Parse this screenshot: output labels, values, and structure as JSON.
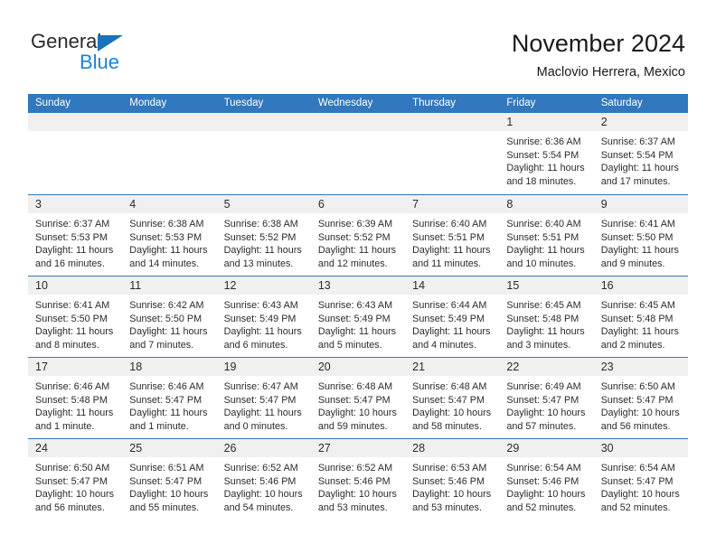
{
  "logo": {
    "word_one": "General",
    "word_two": "Blue",
    "triangle_color": "#1c71b9",
    "blue_color": "#1c82d6"
  },
  "header": {
    "title": "November 2024",
    "subtitle": "Maclovio Herrera, Mexico"
  },
  "theme": {
    "header_bg": "#3178be",
    "header_text": "#ffffff",
    "daynum_band_bg": "#f0f0f0",
    "row_divider": "#3178be",
    "body_text": "#2b2b2b"
  },
  "weekdays": [
    "Sunday",
    "Monday",
    "Tuesday",
    "Wednesday",
    "Thursday",
    "Friday",
    "Saturday"
  ],
  "labels": {
    "sunrise_prefix": "Sunrise:",
    "sunset_prefix": "Sunset:",
    "daylight_prefix": "Daylight:"
  },
  "weeks": [
    [
      {
        "day": "",
        "sunrise": "",
        "sunset": "",
        "daylight_a": "",
        "daylight_b": ""
      },
      {
        "day": "",
        "sunrise": "",
        "sunset": "",
        "daylight_a": "",
        "daylight_b": ""
      },
      {
        "day": "",
        "sunrise": "",
        "sunset": "",
        "daylight_a": "",
        "daylight_b": ""
      },
      {
        "day": "",
        "sunrise": "",
        "sunset": "",
        "daylight_a": "",
        "daylight_b": ""
      },
      {
        "day": "",
        "sunrise": "",
        "sunset": "",
        "daylight_a": "",
        "daylight_b": ""
      },
      {
        "day": "1",
        "sunrise": "Sunrise: 6:36 AM",
        "sunset": "Sunset: 5:54 PM",
        "daylight_a": "Daylight: 11 hours",
        "daylight_b": "and 18 minutes."
      },
      {
        "day": "2",
        "sunrise": "Sunrise: 6:37 AM",
        "sunset": "Sunset: 5:54 PM",
        "daylight_a": "Daylight: 11 hours",
        "daylight_b": "and 17 minutes."
      }
    ],
    [
      {
        "day": "3",
        "sunrise": "Sunrise: 6:37 AM",
        "sunset": "Sunset: 5:53 PM",
        "daylight_a": "Daylight: 11 hours",
        "daylight_b": "and 16 minutes."
      },
      {
        "day": "4",
        "sunrise": "Sunrise: 6:38 AM",
        "sunset": "Sunset: 5:53 PM",
        "daylight_a": "Daylight: 11 hours",
        "daylight_b": "and 14 minutes."
      },
      {
        "day": "5",
        "sunrise": "Sunrise: 6:38 AM",
        "sunset": "Sunset: 5:52 PM",
        "daylight_a": "Daylight: 11 hours",
        "daylight_b": "and 13 minutes."
      },
      {
        "day": "6",
        "sunrise": "Sunrise: 6:39 AM",
        "sunset": "Sunset: 5:52 PM",
        "daylight_a": "Daylight: 11 hours",
        "daylight_b": "and 12 minutes."
      },
      {
        "day": "7",
        "sunrise": "Sunrise: 6:40 AM",
        "sunset": "Sunset: 5:51 PM",
        "daylight_a": "Daylight: 11 hours",
        "daylight_b": "and 11 minutes."
      },
      {
        "day": "8",
        "sunrise": "Sunrise: 6:40 AM",
        "sunset": "Sunset: 5:51 PM",
        "daylight_a": "Daylight: 11 hours",
        "daylight_b": "and 10 minutes."
      },
      {
        "day": "9",
        "sunrise": "Sunrise: 6:41 AM",
        "sunset": "Sunset: 5:50 PM",
        "daylight_a": "Daylight: 11 hours",
        "daylight_b": "and 9 minutes."
      }
    ],
    [
      {
        "day": "10",
        "sunrise": "Sunrise: 6:41 AM",
        "sunset": "Sunset: 5:50 PM",
        "daylight_a": "Daylight: 11 hours",
        "daylight_b": "and 8 minutes."
      },
      {
        "day": "11",
        "sunrise": "Sunrise: 6:42 AM",
        "sunset": "Sunset: 5:50 PM",
        "daylight_a": "Daylight: 11 hours",
        "daylight_b": "and 7 minutes."
      },
      {
        "day": "12",
        "sunrise": "Sunrise: 6:43 AM",
        "sunset": "Sunset: 5:49 PM",
        "daylight_a": "Daylight: 11 hours",
        "daylight_b": "and 6 minutes."
      },
      {
        "day": "13",
        "sunrise": "Sunrise: 6:43 AM",
        "sunset": "Sunset: 5:49 PM",
        "daylight_a": "Daylight: 11 hours",
        "daylight_b": "and 5 minutes."
      },
      {
        "day": "14",
        "sunrise": "Sunrise: 6:44 AM",
        "sunset": "Sunset: 5:49 PM",
        "daylight_a": "Daylight: 11 hours",
        "daylight_b": "and 4 minutes."
      },
      {
        "day": "15",
        "sunrise": "Sunrise: 6:45 AM",
        "sunset": "Sunset: 5:48 PM",
        "daylight_a": "Daylight: 11 hours",
        "daylight_b": "and 3 minutes."
      },
      {
        "day": "16",
        "sunrise": "Sunrise: 6:45 AM",
        "sunset": "Sunset: 5:48 PM",
        "daylight_a": "Daylight: 11 hours",
        "daylight_b": "and 2 minutes."
      }
    ],
    [
      {
        "day": "17",
        "sunrise": "Sunrise: 6:46 AM",
        "sunset": "Sunset: 5:48 PM",
        "daylight_a": "Daylight: 11 hours",
        "daylight_b": "and 1 minute."
      },
      {
        "day": "18",
        "sunrise": "Sunrise: 6:46 AM",
        "sunset": "Sunset: 5:47 PM",
        "daylight_a": "Daylight: 11 hours",
        "daylight_b": "and 1 minute."
      },
      {
        "day": "19",
        "sunrise": "Sunrise: 6:47 AM",
        "sunset": "Sunset: 5:47 PM",
        "daylight_a": "Daylight: 11 hours",
        "daylight_b": "and 0 minutes."
      },
      {
        "day": "20",
        "sunrise": "Sunrise: 6:48 AM",
        "sunset": "Sunset: 5:47 PM",
        "daylight_a": "Daylight: 10 hours",
        "daylight_b": "and 59 minutes."
      },
      {
        "day": "21",
        "sunrise": "Sunrise: 6:48 AM",
        "sunset": "Sunset: 5:47 PM",
        "daylight_a": "Daylight: 10 hours",
        "daylight_b": "and 58 minutes."
      },
      {
        "day": "22",
        "sunrise": "Sunrise: 6:49 AM",
        "sunset": "Sunset: 5:47 PM",
        "daylight_a": "Daylight: 10 hours",
        "daylight_b": "and 57 minutes."
      },
      {
        "day": "23",
        "sunrise": "Sunrise: 6:50 AM",
        "sunset": "Sunset: 5:47 PM",
        "daylight_a": "Daylight: 10 hours",
        "daylight_b": "and 56 minutes."
      }
    ],
    [
      {
        "day": "24",
        "sunrise": "Sunrise: 6:50 AM",
        "sunset": "Sunset: 5:47 PM",
        "daylight_a": "Daylight: 10 hours",
        "daylight_b": "and 56 minutes."
      },
      {
        "day": "25",
        "sunrise": "Sunrise: 6:51 AM",
        "sunset": "Sunset: 5:47 PM",
        "daylight_a": "Daylight: 10 hours",
        "daylight_b": "and 55 minutes."
      },
      {
        "day": "26",
        "sunrise": "Sunrise: 6:52 AM",
        "sunset": "Sunset: 5:46 PM",
        "daylight_a": "Daylight: 10 hours",
        "daylight_b": "and 54 minutes."
      },
      {
        "day": "27",
        "sunrise": "Sunrise: 6:52 AM",
        "sunset": "Sunset: 5:46 PM",
        "daylight_a": "Daylight: 10 hours",
        "daylight_b": "and 53 minutes."
      },
      {
        "day": "28",
        "sunrise": "Sunrise: 6:53 AM",
        "sunset": "Sunset: 5:46 PM",
        "daylight_a": "Daylight: 10 hours",
        "daylight_b": "and 53 minutes."
      },
      {
        "day": "29",
        "sunrise": "Sunrise: 6:54 AM",
        "sunset": "Sunset: 5:46 PM",
        "daylight_a": "Daylight: 10 hours",
        "daylight_b": "and 52 minutes."
      },
      {
        "day": "30",
        "sunrise": "Sunrise: 6:54 AM",
        "sunset": "Sunset: 5:47 PM",
        "daylight_a": "Daylight: 10 hours",
        "daylight_b": "and 52 minutes."
      }
    ]
  ]
}
